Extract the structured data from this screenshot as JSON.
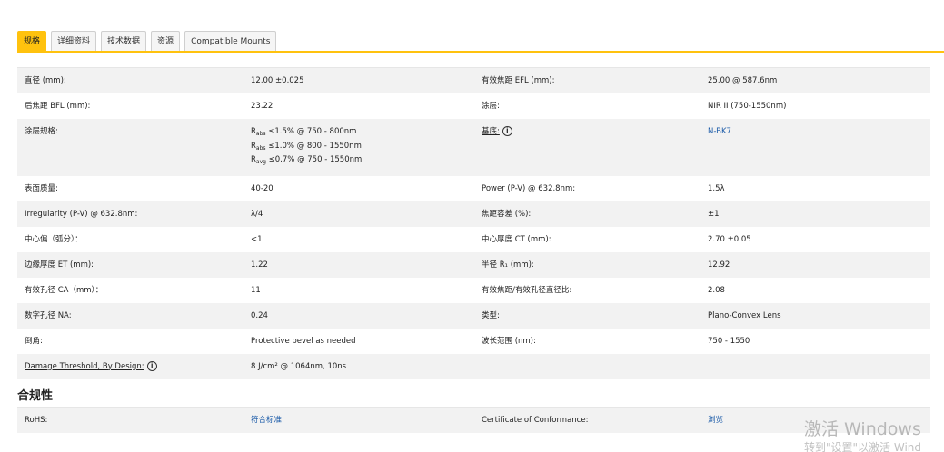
{
  "tabs": [
    {
      "label": "规格",
      "active": true
    },
    {
      "label": "详细资料",
      "active": false
    },
    {
      "label": "技术数据",
      "active": false
    },
    {
      "label": "资源",
      "active": false
    },
    {
      "label": "Compatible Mounts",
      "active": false
    }
  ],
  "specs": [
    {
      "l1": "直径 (mm):",
      "v1": "12.00 ±0.025",
      "l2": "有效焦距 EFL (mm):",
      "v2": "25.00 @ 587.6nm"
    },
    {
      "l1": "后焦距 BFL (mm):",
      "v1": "23.22",
      "l2": "涂层:",
      "v2": "NIR II (750-1550nm)"
    },
    {
      "l1": "涂层规格:",
      "v1_lines": [
        "≤1.5% @ 750 - 800nm",
        "≤1.0% @ 800 - 1550nm",
        "≤0.7% @ 750 - 1550nm"
      ],
      "v1_subs": [
        "abs",
        "abs",
        "avg"
      ],
      "l2": "基底:",
      "v2": "N-BK7"
    },
    {
      "l1": "表面质量:",
      "v1": "40-20",
      "l2": "Power (P-V) @ 632.8nm:",
      "v2": "1.5λ"
    },
    {
      "l1": "Irregularity (P-V) @ 632.8nm:",
      "v1": "λ/4",
      "l2": "焦距容差 (%):",
      "v2": "±1"
    },
    {
      "l1": "中心偏（弧分）：",
      "v1": "<1",
      "l2": "中心厚度 CT (mm):",
      "v2": "2.70 ±0.05"
    },
    {
      "l1": "边缘厚度 ET (mm):",
      "v1": "1.22",
      "l2": "半径 R₁ (mm):",
      "v2": "12.92"
    },
    {
      "l1": "有效孔径 CA（mm）：",
      "v1": "11",
      "l2": "有效焦距/有效孔径直径比:",
      "v2": "2.08"
    },
    {
      "l1": "数字孔径 NA:",
      "v1": "0.24",
      "l2": "类型:",
      "v2": "Plano-Convex Lens"
    },
    {
      "l1": "倒角:",
      "v1": "Protective bevel as needed",
      "l2": "波长范围 (nm):",
      "v2": "750 - 1550"
    },
    {
      "l1": "Damage Threshold, By Design:",
      "v1": "8 J/cm² @ 1064nm, 10ns",
      "l2": "",
      "v2": ""
    }
  ],
  "coating_prefix": "R",
  "compliance": {
    "title": "合规性",
    "rows": [
      {
        "l1": "RoHS:",
        "v1": "符合标准",
        "l2": "Certificate of Conformance:",
        "v2": "浏览"
      }
    ]
  },
  "watermark": {
    "line1": "激活 Windows",
    "line2": "转到\"设置\"以激活 Wind"
  },
  "colors": {
    "accent": "#ffc20e",
    "link": "#1a5aa8",
    "row_alt": "#f2f2f2"
  }
}
